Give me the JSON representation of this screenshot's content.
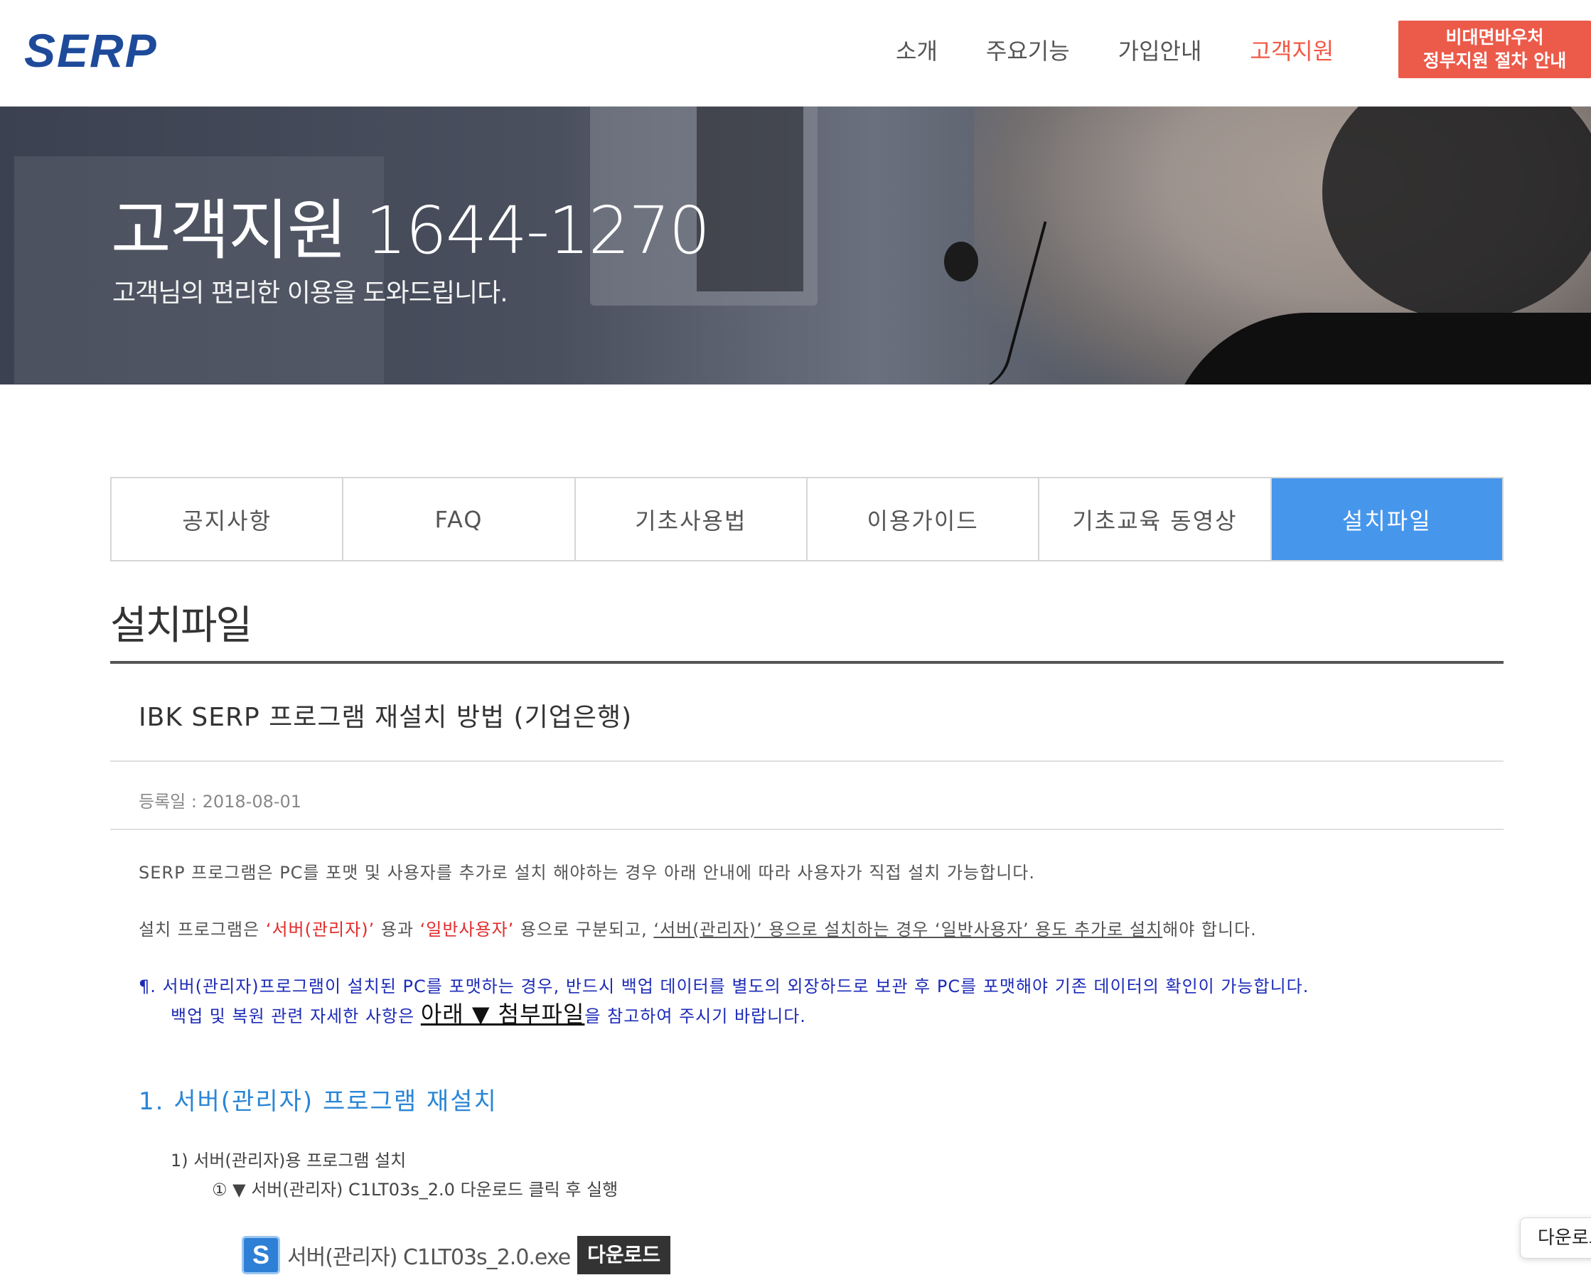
{
  "header": {
    "logo": "SERP",
    "nav": [
      "소개",
      "주요기능",
      "가입안내",
      "고객지원"
    ],
    "active_nav": "고객지원",
    "voucher_line1": "비대면바우처",
    "voucher_line2": "정부지원 절차 안내"
  },
  "hero": {
    "title": "고객지원 1644-1270",
    "subtitle": "고객님의 편리한 이용을 도와드립니다."
  },
  "tabs": [
    "공지사항",
    "FAQ",
    "기초사용법",
    "이용가이드",
    "기초교육 동영상",
    "설치파일"
  ],
  "active_tab": "설치파일",
  "section": {
    "title": "설치파일"
  },
  "post": {
    "title": "IBK SERP 프로그램 재설치 방법 (기업은행)",
    "date": "등록일 : 2018-08-01",
    "p1": "SERP 프로그램은 PC를 포맷 및 사용자를 추가로 설치 해야하는 경우 아래 안내에 따라 사용자가 직접 설치 가능합니다.",
    "p2_a": "설치 프로그램은 ",
    "p2_b": "‘서버(관리자)’",
    "p2_c": " 용과 ",
    "p2_d": "‘일반사용자’",
    "p2_e": " 용으로 구분되고, ",
    "p2_f": "‘서버(관리자)’ 용으로 설치하는 경우 ‘일반사용자’ 용도 추가로 설치",
    "p2_g": "해야 합니다.",
    "p3_line1": "¶. 서버(관리자)프로그램이 설치된 PC를 포맷하는 경우, 반드시 백업 데이터를 별도의 외장하드로 보관 후 PC를 포맷해야 기존 데이터의 확인이 가능합니다.",
    "p3_line2_a": "백업 및 복원 관련 자세한 사항은 ",
    "p3_link": "아래 ▼ 첨부파일",
    "p3_line2_b": "을 참고하여 주시기 바랍니다.",
    "step_heading": "1. 서버(관리자) 프로그램 재설치",
    "step_sub1": "1) 서버(관리자)용 프로그램 설치",
    "step_sub2": "① ▼ 서버(관리자) C1LT03s_2.0 다운로드 클릭 후 실행",
    "download_file": "서버(관리자) C1LT03s_2.0.exe",
    "download_btn": "다운로드",
    "download_icon_letter": "S"
  },
  "floating": {
    "label": "다운로드"
  },
  "colors": {
    "brand_blue": "#1e4a9a",
    "accent_red": "#ec5a4a",
    "tab_active": "#4696ec",
    "heading_blue": "#2a86d6"
  }
}
